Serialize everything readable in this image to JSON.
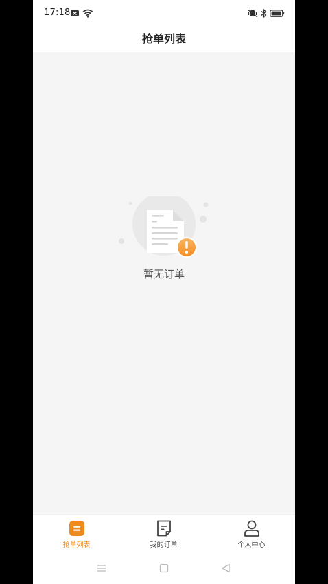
{
  "status_bar": {
    "time": "17:18",
    "icons": [
      "notification-badge-icon",
      "wifi-icon",
      "mute-vibrate-icon",
      "bluetooth-icon",
      "battery-icon"
    ]
  },
  "header": {
    "title": "抢单列表"
  },
  "empty_state": {
    "icon": "empty-document-warning-icon",
    "message": "暂无订单"
  },
  "tab_bar": {
    "accent_color": "#f08a1c",
    "tabs": [
      {
        "label": "抢单列表",
        "icon": "list-icon",
        "active": true
      },
      {
        "label": "我的订单",
        "icon": "order-document-icon",
        "active": false
      },
      {
        "label": "个人中心",
        "icon": "user-icon",
        "active": false
      }
    ]
  },
  "system_nav": {
    "buttons": [
      "menu-icon",
      "home-icon",
      "back-icon"
    ]
  }
}
